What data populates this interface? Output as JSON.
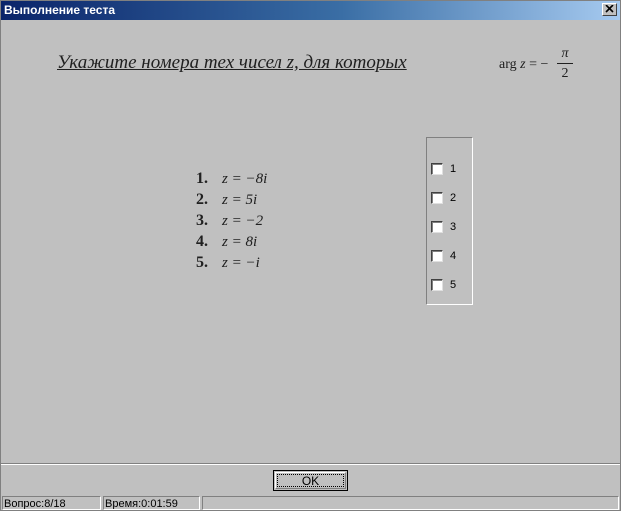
{
  "window": {
    "title": "Выполнение теста",
    "close_glyph": "close-icon"
  },
  "question": {
    "text": "Укажите номера тех чисел z, для которых",
    "formula": {
      "lhs_func": "arg",
      "lhs_var": "z",
      "equals": "= −",
      "numerator": "π",
      "denominator": "2"
    }
  },
  "options": [
    {
      "num": "1.",
      "expr": "z = −8i"
    },
    {
      "num": "2.",
      "expr": "z = 5i"
    },
    {
      "num": "3.",
      "expr": "z = −2"
    },
    {
      "num": "4.",
      "expr": "z = 8i"
    },
    {
      "num": "5.",
      "expr": "z = −i"
    }
  ],
  "checkboxes": [
    {
      "label": "1",
      "checked": false
    },
    {
      "label": "2",
      "checked": false
    },
    {
      "label": "3",
      "checked": false
    },
    {
      "label": "4",
      "checked": false
    },
    {
      "label": "5",
      "checked": false
    }
  ],
  "buttons": {
    "ok_label": "OK"
  },
  "status": {
    "question_progress": "Вопрос:8/18",
    "elapsed_time": "Время:0:01:59"
  },
  "colors": {
    "titlebar_start": "#0a246a",
    "titlebar_end": "#a6caf0",
    "face": "#c0c0c0"
  }
}
